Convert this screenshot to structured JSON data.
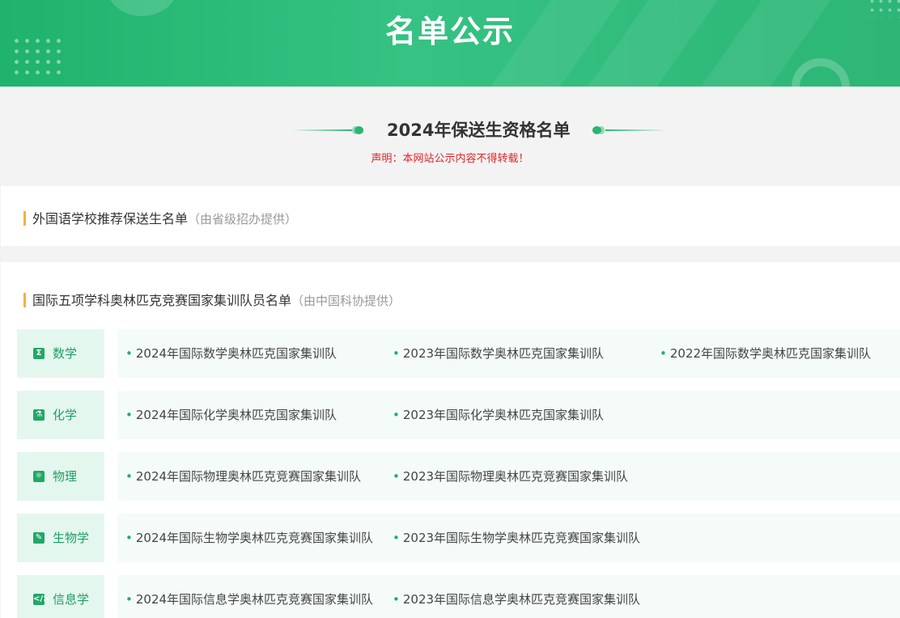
{
  "banner": {
    "title": "名单公示"
  },
  "section": {
    "title": "2024年保送生资格名单",
    "notice": "声明：本网站公示内容不得转载！"
  },
  "foreign_school": {
    "title": "外国语学校推荐保送生名单",
    "source": "（由省级招办提供）"
  },
  "olympiad": {
    "title": "国际五项学科奥林匹克竞赛国家集训队员名单",
    "source": "（由中国科协提供）",
    "subjects": [
      {
        "name": "数学",
        "icon": "sigma-icon",
        "links": [
          "2024年国际数学奥林匹克国家集训队",
          "2023年国际数学奥林匹克国家集训队",
          "2022年国际数学奥林匹克国家集训队"
        ]
      },
      {
        "name": "化学",
        "icon": "flask-icon",
        "links": [
          "2024年国际化学奥林匹克国家集训队",
          "2023年国际化学奥林匹克国家集训队"
        ]
      },
      {
        "name": "物理",
        "icon": "atom-icon",
        "links": [
          "2024年国际物理奥林匹克竞赛国家集训队",
          "2023年国际物理奥林匹克竞赛国家集训队"
        ]
      },
      {
        "name": "生物学",
        "icon": "leaf-icon",
        "links": [
          "2024年国际生物学奥林匹克竞赛国家集训队",
          "2023年国际生物学奥林匹克竞赛国家集训队"
        ]
      },
      {
        "name": "信息学",
        "icon": "code-icon",
        "links": [
          "2024年国际信息学奥林匹克竞赛国家集训队",
          "2023年国际信息学奥林匹克竞赛国家集训队"
        ]
      }
    ]
  },
  "colors": {
    "accent": "#2cb574",
    "notice": "#e0232a",
    "title_bar": "#f0b43b"
  }
}
